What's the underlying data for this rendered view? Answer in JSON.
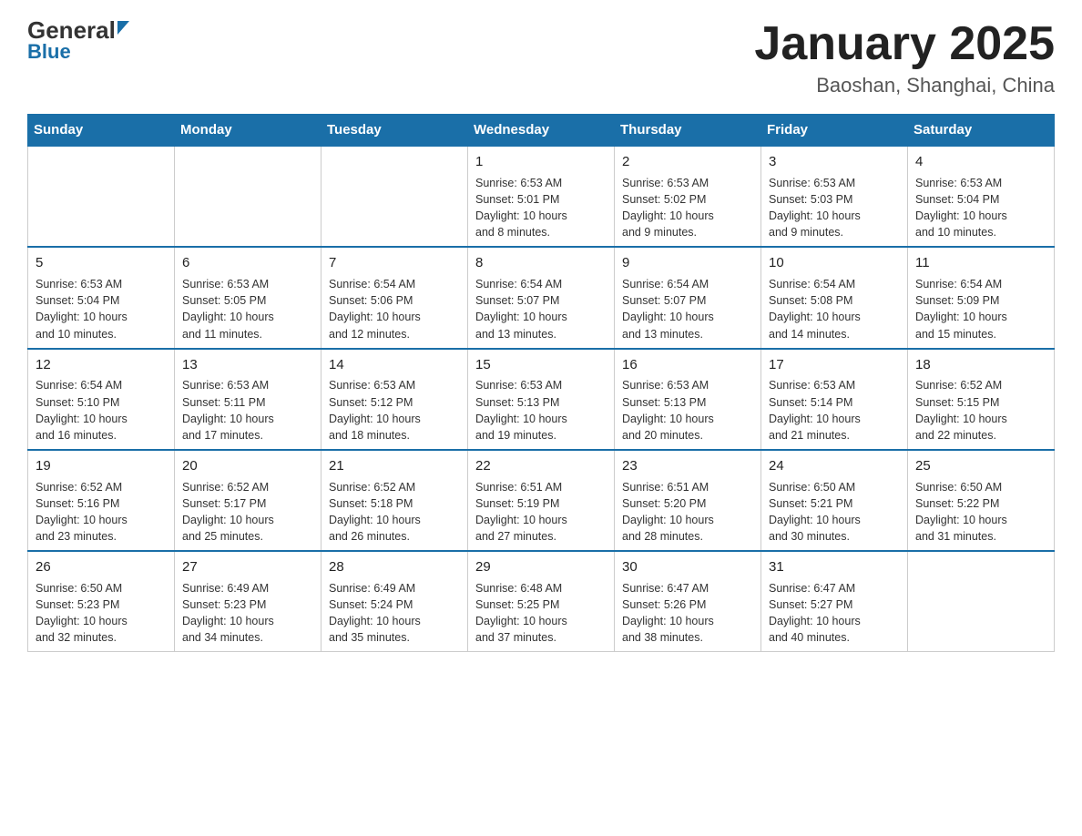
{
  "header": {
    "logo_general": "General",
    "logo_blue": "Blue",
    "title": "January 2025",
    "location": "Baoshan, Shanghai, China"
  },
  "weekdays": [
    "Sunday",
    "Monday",
    "Tuesday",
    "Wednesday",
    "Thursday",
    "Friday",
    "Saturday"
  ],
  "weeks": [
    [
      {
        "day": "",
        "info": ""
      },
      {
        "day": "",
        "info": ""
      },
      {
        "day": "",
        "info": ""
      },
      {
        "day": "1",
        "info": "Sunrise: 6:53 AM\nSunset: 5:01 PM\nDaylight: 10 hours\nand 8 minutes."
      },
      {
        "day": "2",
        "info": "Sunrise: 6:53 AM\nSunset: 5:02 PM\nDaylight: 10 hours\nand 9 minutes."
      },
      {
        "day": "3",
        "info": "Sunrise: 6:53 AM\nSunset: 5:03 PM\nDaylight: 10 hours\nand 9 minutes."
      },
      {
        "day": "4",
        "info": "Sunrise: 6:53 AM\nSunset: 5:04 PM\nDaylight: 10 hours\nand 10 minutes."
      }
    ],
    [
      {
        "day": "5",
        "info": "Sunrise: 6:53 AM\nSunset: 5:04 PM\nDaylight: 10 hours\nand 10 minutes."
      },
      {
        "day": "6",
        "info": "Sunrise: 6:53 AM\nSunset: 5:05 PM\nDaylight: 10 hours\nand 11 minutes."
      },
      {
        "day": "7",
        "info": "Sunrise: 6:54 AM\nSunset: 5:06 PM\nDaylight: 10 hours\nand 12 minutes."
      },
      {
        "day": "8",
        "info": "Sunrise: 6:54 AM\nSunset: 5:07 PM\nDaylight: 10 hours\nand 13 minutes."
      },
      {
        "day": "9",
        "info": "Sunrise: 6:54 AM\nSunset: 5:07 PM\nDaylight: 10 hours\nand 13 minutes."
      },
      {
        "day": "10",
        "info": "Sunrise: 6:54 AM\nSunset: 5:08 PM\nDaylight: 10 hours\nand 14 minutes."
      },
      {
        "day": "11",
        "info": "Sunrise: 6:54 AM\nSunset: 5:09 PM\nDaylight: 10 hours\nand 15 minutes."
      }
    ],
    [
      {
        "day": "12",
        "info": "Sunrise: 6:54 AM\nSunset: 5:10 PM\nDaylight: 10 hours\nand 16 minutes."
      },
      {
        "day": "13",
        "info": "Sunrise: 6:53 AM\nSunset: 5:11 PM\nDaylight: 10 hours\nand 17 minutes."
      },
      {
        "day": "14",
        "info": "Sunrise: 6:53 AM\nSunset: 5:12 PM\nDaylight: 10 hours\nand 18 minutes."
      },
      {
        "day": "15",
        "info": "Sunrise: 6:53 AM\nSunset: 5:13 PM\nDaylight: 10 hours\nand 19 minutes."
      },
      {
        "day": "16",
        "info": "Sunrise: 6:53 AM\nSunset: 5:13 PM\nDaylight: 10 hours\nand 20 minutes."
      },
      {
        "day": "17",
        "info": "Sunrise: 6:53 AM\nSunset: 5:14 PM\nDaylight: 10 hours\nand 21 minutes."
      },
      {
        "day": "18",
        "info": "Sunrise: 6:52 AM\nSunset: 5:15 PM\nDaylight: 10 hours\nand 22 minutes."
      }
    ],
    [
      {
        "day": "19",
        "info": "Sunrise: 6:52 AM\nSunset: 5:16 PM\nDaylight: 10 hours\nand 23 minutes."
      },
      {
        "day": "20",
        "info": "Sunrise: 6:52 AM\nSunset: 5:17 PM\nDaylight: 10 hours\nand 25 minutes."
      },
      {
        "day": "21",
        "info": "Sunrise: 6:52 AM\nSunset: 5:18 PM\nDaylight: 10 hours\nand 26 minutes."
      },
      {
        "day": "22",
        "info": "Sunrise: 6:51 AM\nSunset: 5:19 PM\nDaylight: 10 hours\nand 27 minutes."
      },
      {
        "day": "23",
        "info": "Sunrise: 6:51 AM\nSunset: 5:20 PM\nDaylight: 10 hours\nand 28 minutes."
      },
      {
        "day": "24",
        "info": "Sunrise: 6:50 AM\nSunset: 5:21 PM\nDaylight: 10 hours\nand 30 minutes."
      },
      {
        "day": "25",
        "info": "Sunrise: 6:50 AM\nSunset: 5:22 PM\nDaylight: 10 hours\nand 31 minutes."
      }
    ],
    [
      {
        "day": "26",
        "info": "Sunrise: 6:50 AM\nSunset: 5:23 PM\nDaylight: 10 hours\nand 32 minutes."
      },
      {
        "day": "27",
        "info": "Sunrise: 6:49 AM\nSunset: 5:23 PM\nDaylight: 10 hours\nand 34 minutes."
      },
      {
        "day": "28",
        "info": "Sunrise: 6:49 AM\nSunset: 5:24 PM\nDaylight: 10 hours\nand 35 minutes."
      },
      {
        "day": "29",
        "info": "Sunrise: 6:48 AM\nSunset: 5:25 PM\nDaylight: 10 hours\nand 37 minutes."
      },
      {
        "day": "30",
        "info": "Sunrise: 6:47 AM\nSunset: 5:26 PM\nDaylight: 10 hours\nand 38 minutes."
      },
      {
        "day": "31",
        "info": "Sunrise: 6:47 AM\nSunset: 5:27 PM\nDaylight: 10 hours\nand 40 minutes."
      },
      {
        "day": "",
        "info": ""
      }
    ]
  ]
}
